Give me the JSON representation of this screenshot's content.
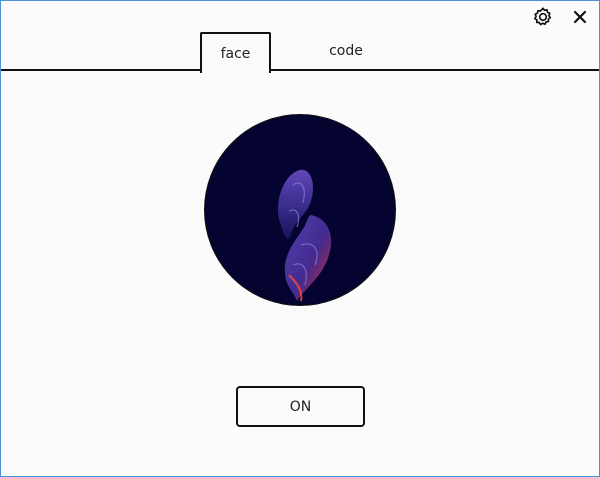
{
  "window": {
    "border_color": "#4a90d9",
    "background": "#fbfbfb"
  },
  "titlebar": {
    "settings_icon": "gear-icon",
    "close_icon": "close-icon"
  },
  "tabs": [
    {
      "label": "face",
      "active": true
    },
    {
      "label": "code",
      "active": false
    }
  ],
  "face_view": {
    "avatar_icon": "abstract-swirl-image",
    "avatar_background": "#05032f",
    "accent_colors": [
      "#4b3c9e",
      "#e0322d"
    ]
  },
  "toggle_button": {
    "label": "ON"
  }
}
